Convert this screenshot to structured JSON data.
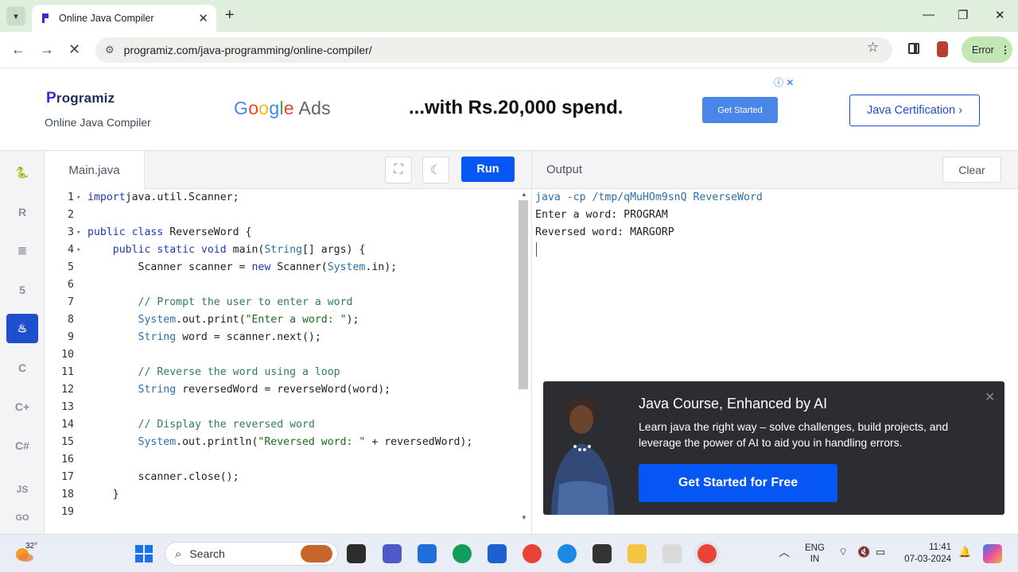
{
  "browser": {
    "tab_title": "Online Java Compiler",
    "tab_close": "✕",
    "new_tab": "+",
    "url": "programiz.com/java-programming/online-compiler/",
    "error_label": "Error",
    "window_controls": {
      "minimize": "—",
      "maximize": "❐",
      "close": "✕"
    }
  },
  "header": {
    "logo_letter": "P",
    "logo_rest": "rogramiz",
    "subtitle": "Online Java Compiler",
    "ad": {
      "google": [
        "G",
        "o",
        "o",
        "g",
        "l",
        "e"
      ],
      "google_colors": [
        "#4285F4",
        "#EA4335",
        "#FBBC05",
        "#4285F4",
        "#34A853",
        "#EA4335"
      ],
      "ads_word": "Ads",
      "text": "...with Rs.20,000 spend.",
      "button": "Get Started",
      "info": "ⓘ ✕"
    },
    "cert_button": "Java Certification ›"
  },
  "sidebar": {
    "items": [
      {
        "name": "python",
        "label": "🐍"
      },
      {
        "name": "r",
        "label": "R"
      },
      {
        "name": "sql",
        "label": "≣"
      },
      {
        "name": "html",
        "label": "5"
      },
      {
        "name": "java",
        "label": "♨",
        "active": true
      },
      {
        "name": "c",
        "label": "C"
      },
      {
        "name": "cpp",
        "label": "C+"
      },
      {
        "name": "csharp",
        "label": "C#"
      },
      {
        "name": "js",
        "label": "JS"
      },
      {
        "name": "go",
        "label": "GO"
      }
    ]
  },
  "editor": {
    "file_tab": "Main.java",
    "run_label": "Run",
    "lines": [
      {
        "n": "1",
        "fold": true,
        "code": [
          [
            "kw",
            "import"
          ],
          [
            "",
            "java.util.Scanner;"
          ]
        ]
      },
      {
        "n": "2",
        "code": []
      },
      {
        "n": "3",
        "fold": true,
        "code": [
          [
            "kw",
            "public class"
          ],
          [
            "",
            " ReverseWord {"
          ]
        ]
      },
      {
        "n": "4",
        "fold": true,
        "code": [
          [
            "",
            "    "
          ],
          [
            "kw",
            "public static void"
          ],
          [
            "",
            " main("
          ],
          [
            "ty",
            "String"
          ],
          [
            "",
            "[] args) {"
          ]
        ]
      },
      {
        "n": "5",
        "code": [
          [
            "",
            "        Scanner scanner = "
          ],
          [
            "kw",
            "new"
          ],
          [
            "",
            " Scanner("
          ],
          [
            "ty",
            "System"
          ],
          [
            "",
            ".in);"
          ]
        ]
      },
      {
        "n": "6",
        "code": []
      },
      {
        "n": "7",
        "code": [
          [
            "",
            "        "
          ],
          [
            "cm",
            "// Prompt the user to enter a word"
          ]
        ]
      },
      {
        "n": "8",
        "code": [
          [
            "",
            "        "
          ],
          [
            "ty",
            "System"
          ],
          [
            "",
            ".out.print("
          ],
          [
            "st",
            "\"Enter a word: \""
          ],
          [
            "",
            ");"
          ]
        ]
      },
      {
        "n": "9",
        "code": [
          [
            "",
            "        "
          ],
          [
            "ty",
            "String"
          ],
          [
            "",
            " word = scanner.next();"
          ]
        ]
      },
      {
        "n": "10",
        "code": []
      },
      {
        "n": "11",
        "code": [
          [
            "",
            "        "
          ],
          [
            "cm",
            "// Reverse the word using a loop"
          ]
        ]
      },
      {
        "n": "12",
        "code": [
          [
            "",
            "        "
          ],
          [
            "ty",
            "String"
          ],
          [
            "",
            " reversedWord = reverseWord(word);"
          ]
        ]
      },
      {
        "n": "13",
        "code": []
      },
      {
        "n": "14",
        "code": [
          [
            "",
            "        "
          ],
          [
            "cm",
            "// Display the reversed word"
          ]
        ]
      },
      {
        "n": "15",
        "code": [
          [
            "",
            "        "
          ],
          [
            "ty",
            "System"
          ],
          [
            "",
            ".out.println("
          ],
          [
            "st",
            "\"Reversed word: \""
          ],
          [
            "",
            " + reversedWord);"
          ]
        ]
      },
      {
        "n": "16",
        "code": []
      },
      {
        "n": "17",
        "code": [
          [
            "",
            "        scanner.close();"
          ]
        ]
      },
      {
        "n": "18",
        "code": [
          [
            "",
            "    }"
          ]
        ]
      },
      {
        "n": "19",
        "code": []
      }
    ]
  },
  "output": {
    "label": "Output",
    "clear_label": "Clear",
    "lines": [
      "java -cp /tmp/qMuHOm9snQ ReverseWord",
      "Enter a word: PROGRAM",
      "Reversed word: MARGORP"
    ]
  },
  "promo": {
    "title": "Java Course, Enhanced by AI",
    "desc": "Learn java the right way – solve challenges, build projects, and leverage the power of AI to aid you in handling errors.",
    "button": "Get Started for Free",
    "close": "✕"
  },
  "taskbar": {
    "temp": "32°",
    "search_placeholder": "Search",
    "lang_top": "ENG",
    "lang_bottom": "IN",
    "time": "11:41",
    "date": "07-03-2024"
  }
}
